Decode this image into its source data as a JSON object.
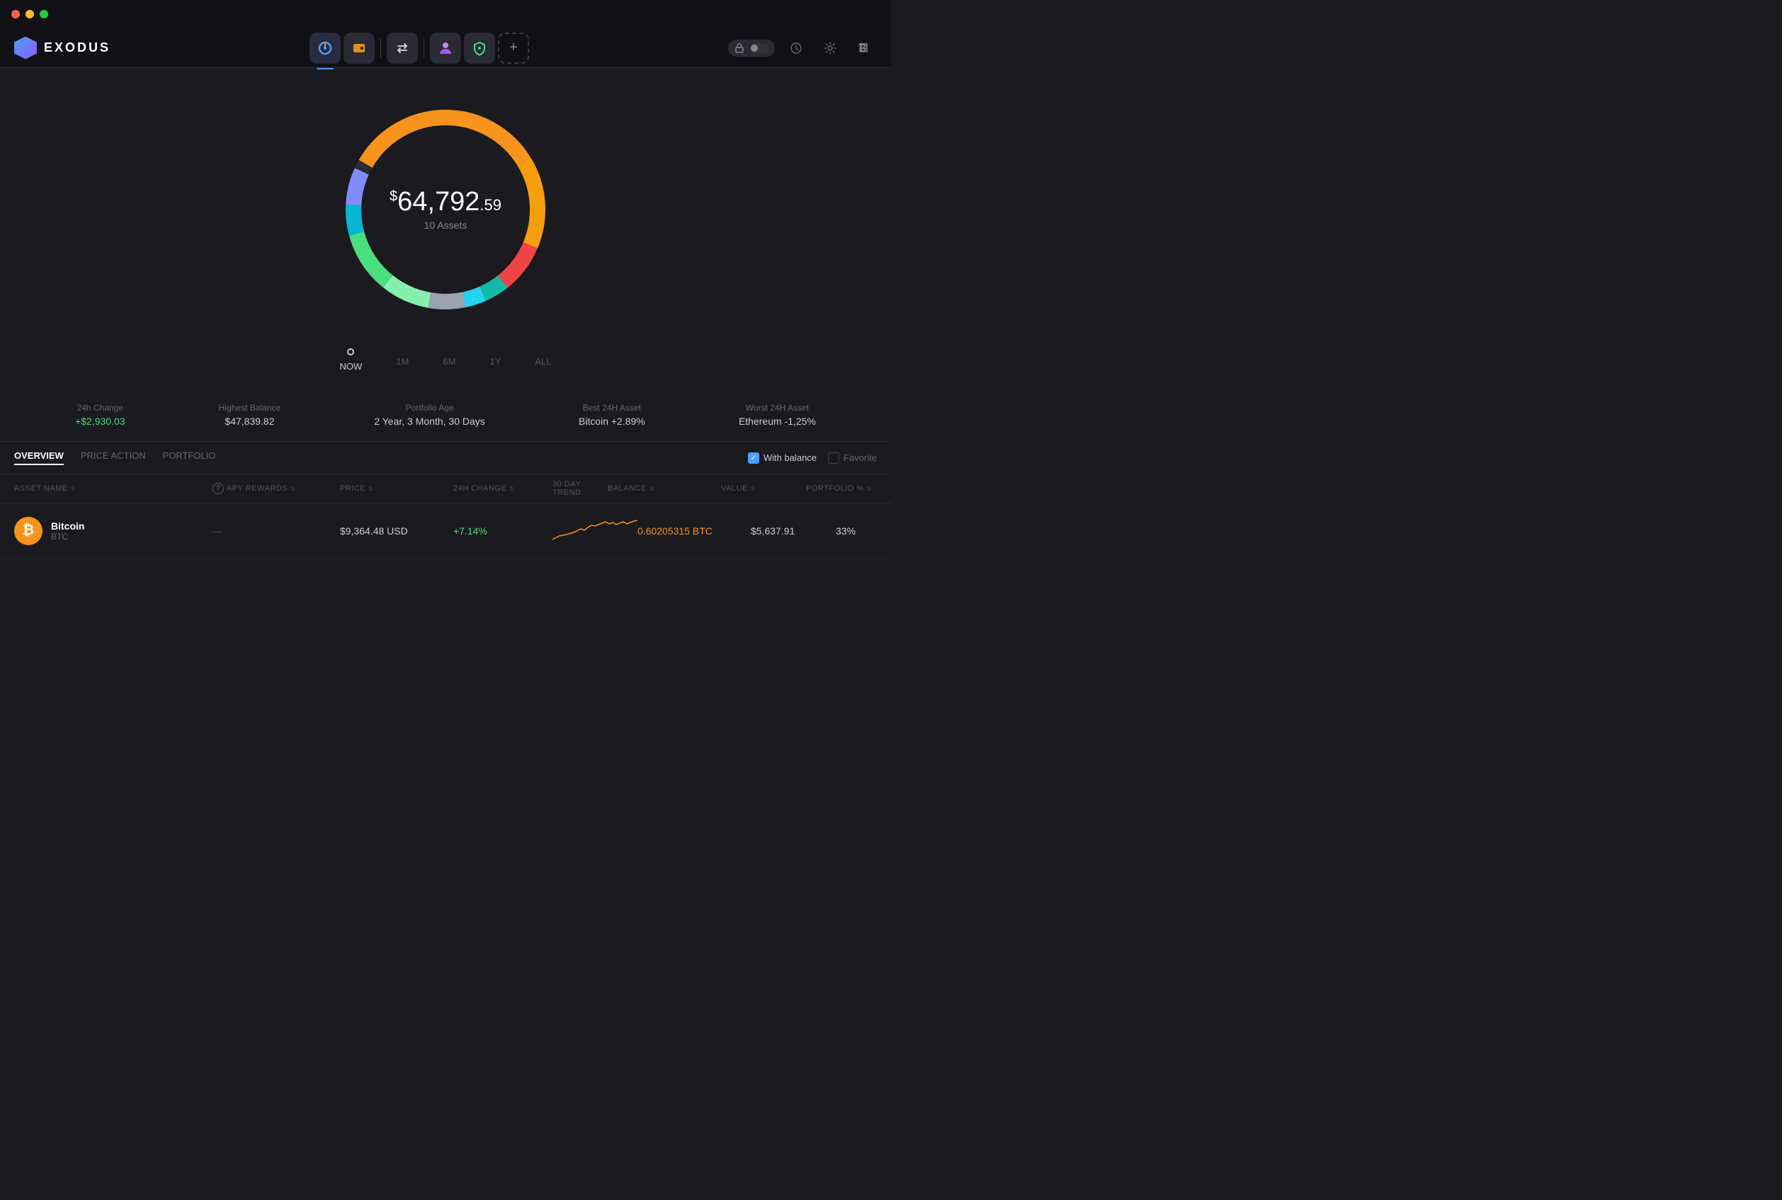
{
  "titlebar": {
    "dots": [
      "red",
      "yellow",
      "green"
    ]
  },
  "logo": {
    "text": "EXODUS"
  },
  "nav": {
    "add_btn": "+",
    "right_buttons": [
      "lock",
      "history",
      "settings",
      "grid"
    ]
  },
  "portfolio": {
    "amount_currency": "$",
    "amount_main": "64,792",
    "amount_cents": ".59",
    "assets_label": "10 Assets",
    "donut_segments": [
      {
        "color": "#f7931a",
        "percent": 33,
        "start": 0
      },
      {
        "color": "#f59e0b",
        "percent": 15,
        "start": 33
      },
      {
        "color": "#ef4444",
        "percent": 8,
        "start": 48
      },
      {
        "color": "#14b8a6",
        "percent": 5,
        "start": 56
      },
      {
        "color": "#22d3ee",
        "percent": 4,
        "start": 61
      },
      {
        "color": "#e5e7eb",
        "percent": 6,
        "start": 65
      },
      {
        "color": "#86efac",
        "percent": 8,
        "start": 71
      },
      {
        "color": "#4ade80",
        "percent": 10,
        "start": 79
      },
      {
        "color": "#06b6d4",
        "percent": 5,
        "start": 89
      },
      {
        "color": "#818cf8",
        "percent": 6,
        "start": 94
      }
    ]
  },
  "time_selector": {
    "options": [
      "NOW",
      "1M",
      "6M",
      "1Y",
      "ALL"
    ]
  },
  "stats": [
    {
      "label": "24h Change",
      "value": "+$2,930.03",
      "positive": true
    },
    {
      "label": "Highest Balance",
      "value": "$47,839.82",
      "positive": false
    },
    {
      "label": "Portfolio Age",
      "value": "2 Year, 3 Month, 30 Days",
      "positive": false
    },
    {
      "label": "Best 24H Asset",
      "value": "Bitcoin +2.89%",
      "positive": false
    },
    {
      "label": "Worst 24H Asset",
      "value": "Ethereum -1,25%",
      "positive": false
    }
  ],
  "tabs": {
    "items": [
      {
        "label": "OVERVIEW",
        "active": true
      },
      {
        "label": "PRICE ACTION",
        "active": false
      },
      {
        "label": "PORTFOLIO",
        "active": false
      }
    ],
    "with_balance": "With balance",
    "favorite": "Favorite"
  },
  "table": {
    "headers": [
      {
        "label": "ASSET NAME",
        "sortable": true
      },
      {
        "label": "APY REWARDS",
        "sortable": true,
        "has_help": true
      },
      {
        "label": "PRICE",
        "sortable": true
      },
      {
        "label": "24H CHANGE",
        "sortable": true
      },
      {
        "label": "30 DAY TREND",
        "sortable": false
      },
      {
        "label": "BALANCE",
        "sortable": true
      },
      {
        "label": "VALUE",
        "sortable": true
      },
      {
        "label": "PORTFOLIO %",
        "sortable": true
      }
    ],
    "rows": [
      {
        "name": "Bitcoin",
        "symbol": "BTC",
        "icon": "₿",
        "icon_bg": "#f7931a",
        "price": "$9,364.48 USD",
        "change": "+7.14%",
        "change_positive": true,
        "balance": "0.60205315 BTC",
        "value": "$5,637.91",
        "portfolio": "33%"
      }
    ]
  }
}
